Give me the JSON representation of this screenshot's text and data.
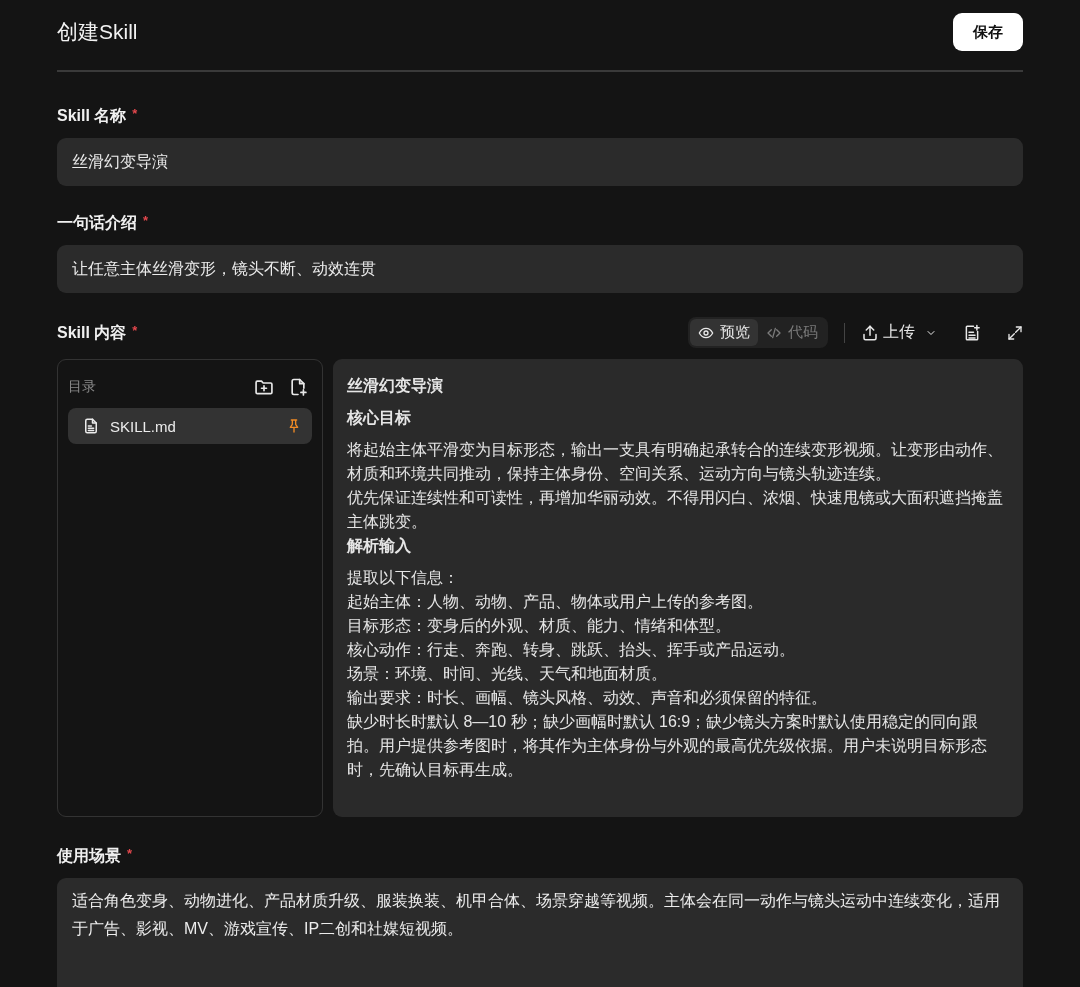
{
  "header": {
    "title": "创建Skill",
    "save_button": "保存"
  },
  "fields": [
    {
      "kind": "input",
      "label": "Skill 名称",
      "required_mark": "*",
      "value": "丝滑幻变导演"
    },
    {
      "kind": "input",
      "label": "一句话介绍",
      "required_mark": "*",
      "value": "让任意主体丝滑变形，镜头不断、动效连贯"
    },
    {
      "kind": "editor",
      "label": "Skill 内容",
      "required_mark": "*",
      "view_modes": [
        {
          "kind": "preview",
          "label": "预览",
          "selected": true
        },
        {
          "kind": "code",
          "label": "代码",
          "selected": false
        }
      ],
      "upload_button": "上传",
      "file_tree": {
        "title": "目录",
        "files": [
          {
            "name": "SKILL.md",
            "selected": true,
            "pinned": true
          }
        ]
      },
      "preview": [
        {
          "kind": "title",
          "text": "丝滑幻变导演"
        },
        {
          "kind": "heading",
          "text": "核心目标"
        },
        {
          "kind": "paragraph",
          "text": "将起始主体平滑变为目标形态，输出一支具有明确起承转合的连续变形视频。让变形由动作、材质和环境共同推动，保持主体身份、空间关系、运动方向与镜头轨迹连续。"
        },
        {
          "kind": "paragraph",
          "text": "优先保证连续性和可读性，再增加华丽动效。不得用闪白、浓烟、快速甩镜或大面积遮挡掩盖主体跳变。"
        },
        {
          "kind": "heading",
          "text": "解析输入"
        },
        {
          "kind": "paragraph",
          "text": "提取以下信息："
        },
        {
          "kind": "paragraph",
          "text": "起始主体：人物、动物、产品、物体或用户上传的参考图。"
        },
        {
          "kind": "paragraph",
          "text": "目标形态：变身后的外观、材质、能力、情绪和体型。"
        },
        {
          "kind": "paragraph",
          "text": "核心动作：行走、奔跑、转身、跳跃、抬头、挥手或产品运动。"
        },
        {
          "kind": "paragraph",
          "text": "场景：环境、时间、光线、天气和地面材质。"
        },
        {
          "kind": "paragraph",
          "text": "输出要求：时长、画幅、镜头风格、动效、声音和必须保留的特征。"
        },
        {
          "kind": "paragraph",
          "text": "缺少时长时默认 8—10 秒；缺少画幅时默认 16:9；缺少镜头方案时默认使用稳定的同向跟拍。用户提供参考图时，将其作为主体身份与外观的最高优先级依据。用户未说明目标形态时，先确认目标再生成。"
        }
      ]
    },
    {
      "kind": "textarea",
      "label": "使用场景",
      "required_mark": "*",
      "value": "适合角色变身、动物进化、产品材质升级、服装换装、机甲合体、场景穿越等视频。主体会在同一动作与镜头运动中连续变化，适用于广告、影视、MV、游戏宣传、IP二创和社媒短视频。"
    }
  ]
}
